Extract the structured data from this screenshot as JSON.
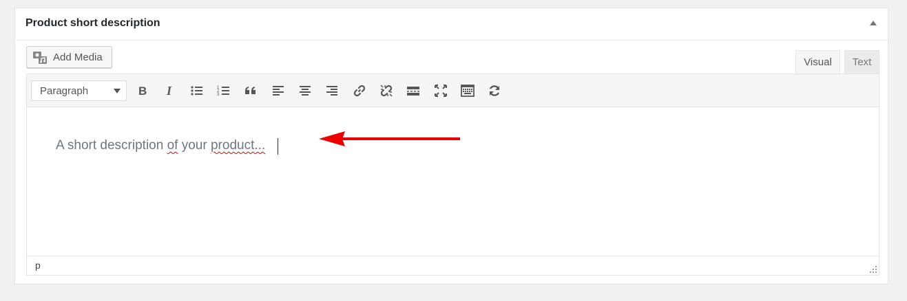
{
  "metabox": {
    "title": "Product short description"
  },
  "media": {
    "add_media_label": "Add Media"
  },
  "tabs": {
    "visual": "Visual",
    "text": "Text"
  },
  "toolbar": {
    "format_value": "Paragraph",
    "buttons": [
      "bold-icon",
      "italic-icon",
      "bulleted-list-icon",
      "numbered-list-icon",
      "blockquote-icon",
      "align-left-icon",
      "align-center-icon",
      "align-right-icon",
      "insert-link-icon",
      "remove-link-icon",
      "read-more-icon",
      "fullscreen-icon",
      "toolbar-toggle-icon",
      "refresh-icon"
    ]
  },
  "editor": {
    "placeholder_part1": "A short description ",
    "placeholder_part2": "of",
    "placeholder_part3": " your ",
    "placeholder_part4": "product...",
    "annotation_color": "#e00"
  },
  "statusbar": {
    "path": "p"
  }
}
